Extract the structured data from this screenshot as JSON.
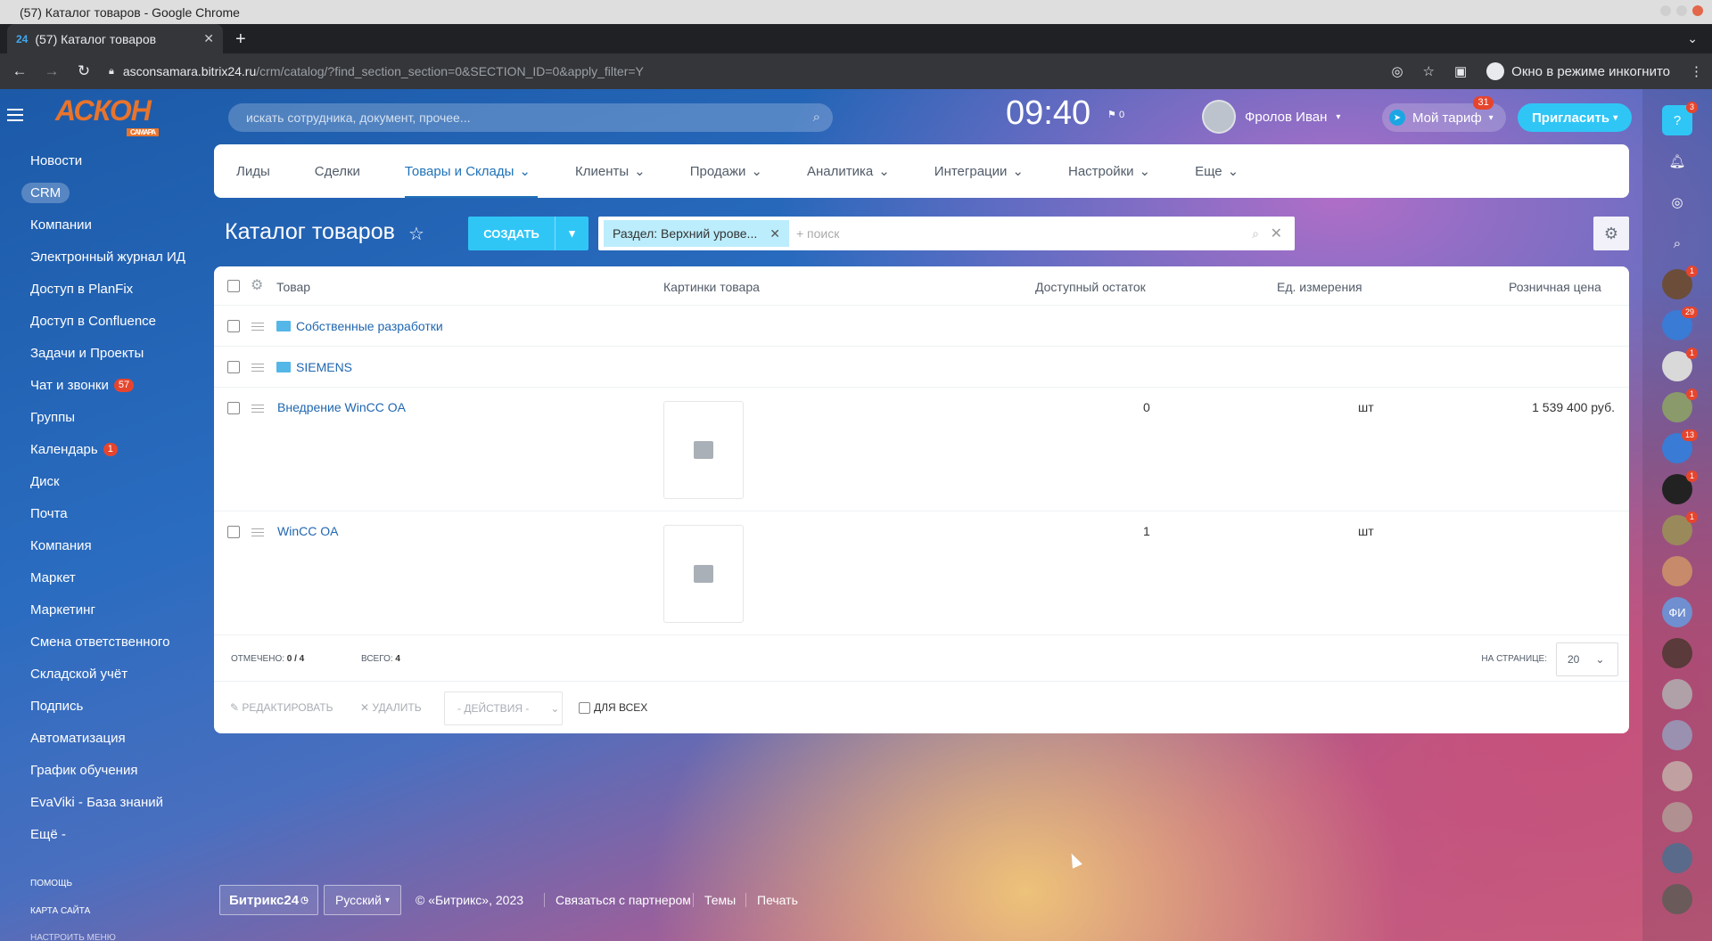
{
  "window": {
    "title": "(57) Каталог товаров - Google Chrome"
  },
  "browser": {
    "tab_title": "(57) Каталог товаров",
    "tab_favicon": "24",
    "url_host": "asconsamara.bitrix24.ru",
    "url_path": "/crm/catalog/?find_section_section=0&SECTION_ID=0&apply_filter=Y",
    "incognito_label": "Окно в режиме инкогнито"
  },
  "header": {
    "logo_text": "АСКОН",
    "logo_sub": "САМАРА",
    "search_placeholder": "искать сотрудника, документ, прочее...",
    "clock": "09:40",
    "flag_count": "0",
    "user_name": "Фролов Иван",
    "tariff_label": "Мой тариф",
    "tariff_badge": "31",
    "invite_label": "Пригласить"
  },
  "sidebar": {
    "items": [
      {
        "label": "Новости"
      },
      {
        "label": "CRM"
      },
      {
        "label": "Компании"
      },
      {
        "label": "Электронный журнал ИД"
      },
      {
        "label": "Доступ в PlanFix"
      },
      {
        "label": "Доступ в Confluence"
      },
      {
        "label": "Задачи и Проекты"
      },
      {
        "label": "Чат и звонки",
        "badge": "57"
      },
      {
        "label": "Группы"
      },
      {
        "label": "Календарь",
        "badge": "1"
      },
      {
        "label": "Диск"
      },
      {
        "label": "Почта"
      },
      {
        "label": "Компания"
      },
      {
        "label": "Маркет"
      },
      {
        "label": "Маркетинг"
      },
      {
        "label": "Смена ответственного"
      },
      {
        "label": "Складской учёт"
      },
      {
        "label": "Подпись"
      },
      {
        "label": "Автоматизация"
      },
      {
        "label": "График обучения"
      },
      {
        "label": "EvaViki - База знаний"
      },
      {
        "label": "Ещё -"
      }
    ],
    "help": "помощь",
    "sitemap": "карта сайта",
    "settings": "настроить меню"
  },
  "topnav": {
    "tabs": [
      {
        "label": "Лиды"
      },
      {
        "label": "Сделки"
      },
      {
        "label": "Товары и Склады"
      },
      {
        "label": "Клиенты"
      },
      {
        "label": "Продажи"
      },
      {
        "label": "Аналитика"
      },
      {
        "label": "Интеграции"
      },
      {
        "label": "Настройки"
      },
      {
        "label": "Еще"
      }
    ]
  },
  "page": {
    "title": "Каталог товаров",
    "create_label": "СОЗДАТЬ",
    "filter_chip": "Раздел: Верхний урове...",
    "filter_placeholder": "поиск",
    "filter_plus": "+"
  },
  "grid": {
    "columns": [
      "Товар",
      "Картинки товара",
      "Доступный остаток",
      "Ед. измерения",
      "Розничная цена"
    ],
    "rows": [
      {
        "name": "Собственные разработки",
        "type": "folder",
        "stock": "",
        "unit": "",
        "price": ""
      },
      {
        "name": "SIEMENS",
        "type": "folder",
        "stock": "",
        "unit": "",
        "price": ""
      },
      {
        "name": "Внедрение WinCC OA",
        "type": "product",
        "stock": "0",
        "unit": "шт",
        "price": "1 539 400 руб."
      },
      {
        "name": "WinCC OA",
        "type": "product",
        "stock": "1",
        "unit": "шт",
        "price": ""
      }
    ],
    "marked_label": "ОТМЕЧЕНО:",
    "marked_value": "0 / 4",
    "total_label": "ВСЕГО:",
    "total_value": "4",
    "per_page_label": "НА СТРАНИЦЕ:",
    "per_page_value": "20",
    "edit_label": "РЕДАКТИРОВАТЬ",
    "delete_label": "УДАЛИТЬ",
    "actions_label": "- ДЕЙСТВИЯ -",
    "for_all_label": "ДЛЯ ВСЕХ"
  },
  "footer": {
    "brand": "Битрикс24",
    "lang": "Русский",
    "copyright": "© «Битрикс», 2023",
    "partner": "Связаться с партнером",
    "themes": "Темы",
    "print": "Печать"
  },
  "rightbar": {
    "help_badge": "3",
    "badges": [
      "1",
      "29",
      "1",
      "1",
      "13",
      "1",
      "1"
    ],
    "initials": "ФИ"
  }
}
